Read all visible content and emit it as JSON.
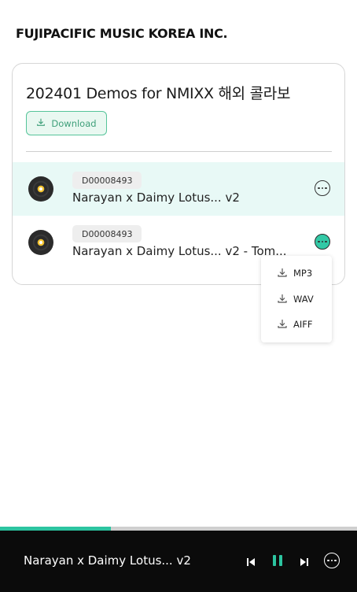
{
  "header": {
    "brand": "FUJIPACIFIC MUSIC KOREA INC."
  },
  "album": {
    "title": "202401 Demos for NMIXX 해외 콜라보",
    "download_label": "Download"
  },
  "tracks": [
    {
      "code": "D00008493",
      "title": "Narayan x Daimy Lotus... v2",
      "active": true
    },
    {
      "code": "D00008493",
      "title": "Narayan x Daimy Lotus... v2 - Tom...",
      "active": false
    }
  ],
  "download_menu": {
    "items": [
      {
        "label": "MP3"
      },
      {
        "label": "WAV"
      },
      {
        "label": "AIFF"
      }
    ]
  },
  "player": {
    "now_playing": "Narayan x Daimy Lotus... v2",
    "progress": 0.31
  },
  "colors": {
    "accent": "#2cc4a0",
    "active_row": "#e8f9f6",
    "player_bg": "#0b0b0b"
  },
  "icons": [
    "download-icon",
    "vinyl-disc-icon",
    "more-options-icon",
    "previous-track-icon",
    "pause-icon",
    "next-track-icon"
  ]
}
